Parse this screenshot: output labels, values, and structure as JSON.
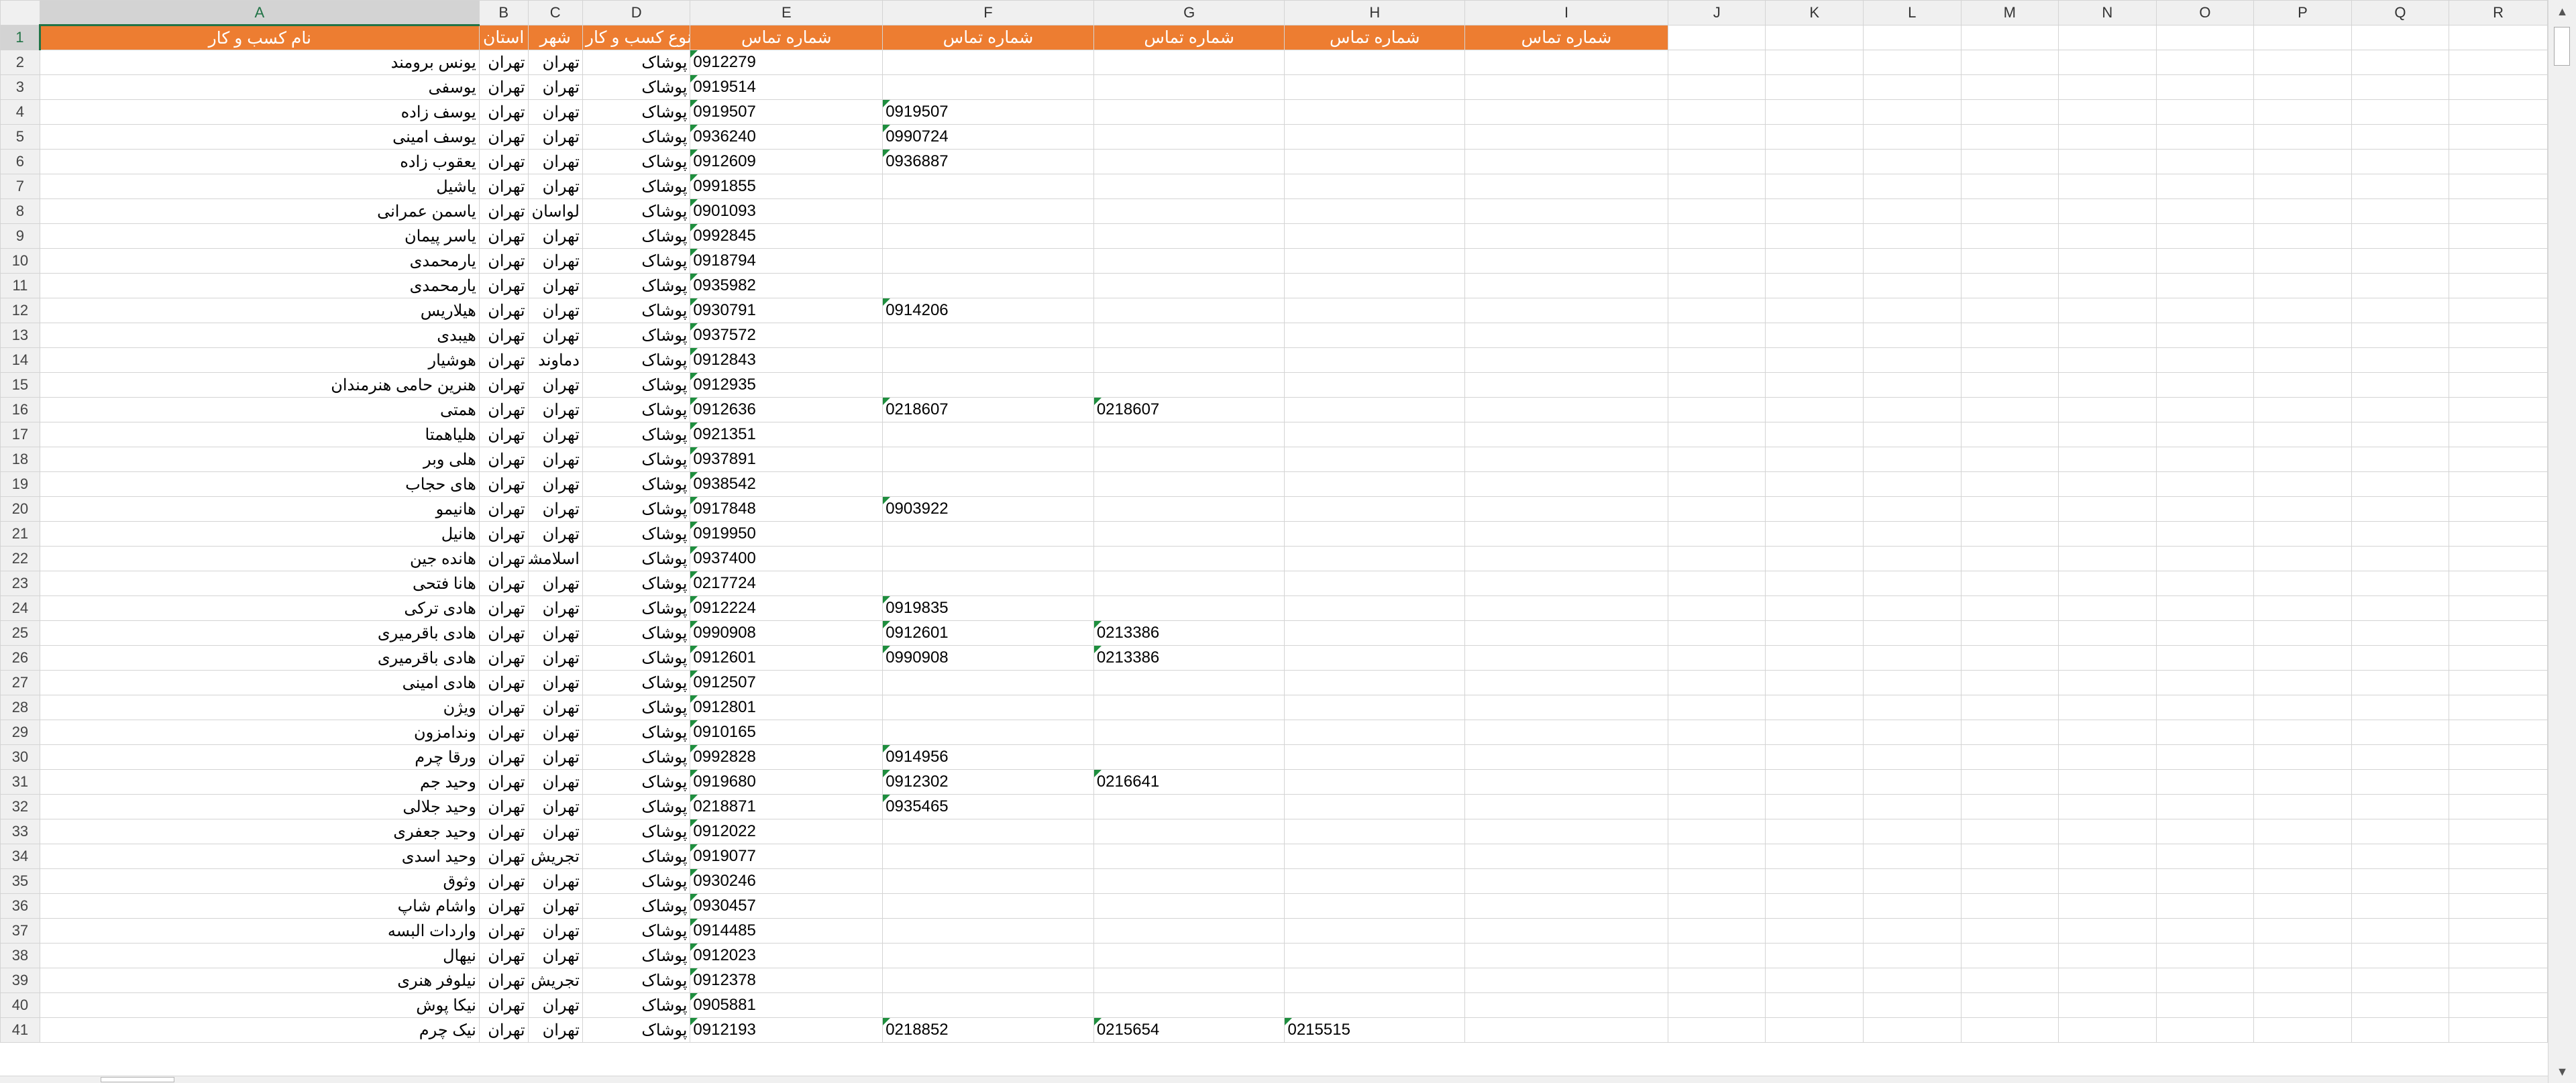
{
  "columns": [
    "A",
    "B",
    "C",
    "D",
    "E",
    "F",
    "G",
    "H",
    "I",
    "J",
    "K",
    "L",
    "M",
    "N",
    "O",
    "P",
    "Q",
    "R"
  ],
  "header_row": {
    "row_number": "1",
    "labels": [
      "نام کسب و کار",
      "استان",
      "شهر",
      "نوع کسب و کار",
      "شماره تماس",
      "شماره تماس",
      "شماره تماس",
      "شماره تماس",
      "شماره تماس"
    ]
  },
  "rows": [
    {
      "n": "2",
      "name": "یونس برومند",
      "province": "تهران",
      "city": "تهران",
      "type": "پوشاک",
      "p1": "0912279",
      "p2": "",
      "p3": "",
      "p4": ""
    },
    {
      "n": "3",
      "name": "یوسفی",
      "province": "تهران",
      "city": "تهران",
      "type": "پوشاک",
      "p1": "0919514",
      "p2": "",
      "p3": "",
      "p4": ""
    },
    {
      "n": "4",
      "name": "یوسف زاده",
      "province": "تهران",
      "city": "تهران",
      "type": "پوشاک",
      "p1": "0919507",
      "p2": "0919507",
      "p3": "",
      "p4": ""
    },
    {
      "n": "5",
      "name": "یوسف امینی",
      "province": "تهران",
      "city": "تهران",
      "type": "پوشاک",
      "p1": "0936240",
      "p2": "0990724",
      "p3": "",
      "p4": ""
    },
    {
      "n": "6",
      "name": "یعقوب زاده",
      "province": "تهران",
      "city": "تهران",
      "type": "پوشاک",
      "p1": "0912609",
      "p2": "0936887",
      "p3": "",
      "p4": ""
    },
    {
      "n": "7",
      "name": "یاشیل",
      "province": "تهران",
      "city": "تهران",
      "type": "پوشاک",
      "p1": "0991855",
      "p2": "",
      "p3": "",
      "p4": ""
    },
    {
      "n": "8",
      "name": "یاسمن عمرانی",
      "province": "تهران",
      "city": "لواسان",
      "type": "پوشاک",
      "p1": "0901093",
      "p2": "",
      "p3": "",
      "p4": ""
    },
    {
      "n": "9",
      "name": "یاسر پیمان",
      "province": "تهران",
      "city": "تهران",
      "type": "پوشاک",
      "p1": "0992845",
      "p2": "",
      "p3": "",
      "p4": ""
    },
    {
      "n": "10",
      "name": "یارمحمدی",
      "province": "تهران",
      "city": "تهران",
      "type": "پوشاک",
      "p1": "0918794",
      "p2": "",
      "p3": "",
      "p4": ""
    },
    {
      "n": "11",
      "name": "یارمحمدی",
      "province": "تهران",
      "city": "تهران",
      "type": "پوشاک",
      "p1": "0935982",
      "p2": "",
      "p3": "",
      "p4": ""
    },
    {
      "n": "12",
      "name": "هیلاریس",
      "province": "تهران",
      "city": "تهران",
      "type": "پوشاک",
      "p1": "0930791",
      "p2": "0914206",
      "p3": "",
      "p4": ""
    },
    {
      "n": "13",
      "name": "هیبدی",
      "province": "تهران",
      "city": "تهران",
      "type": "پوشاک",
      "p1": "0937572",
      "p2": "",
      "p3": "",
      "p4": ""
    },
    {
      "n": "14",
      "name": "هوشیار",
      "province": "تهران",
      "city": "دماوند",
      "type": "پوشاک",
      "p1": "0912843",
      "p2": "",
      "p3": "",
      "p4": ""
    },
    {
      "n": "15",
      "name": "هنرین حامی هنرمندان",
      "province": "تهران",
      "city": "تهران",
      "type": "پوشاک",
      "p1": "0912935",
      "p2": "",
      "p3": "",
      "p4": ""
    },
    {
      "n": "16",
      "name": "همتی",
      "province": "تهران",
      "city": "تهران",
      "type": "پوشاک",
      "p1": "0912636",
      "p2": "0218607",
      "p3": "0218607",
      "p4": ""
    },
    {
      "n": "17",
      "name": "هلیاهمتا",
      "province": "تهران",
      "city": "تهران",
      "type": "پوشاک",
      "p1": "0921351",
      "p2": "",
      "p3": "",
      "p4": ""
    },
    {
      "n": "18",
      "name": "هلی وبر",
      "province": "تهران",
      "city": "تهران",
      "type": "پوشاک",
      "p1": "0937891",
      "p2": "",
      "p3": "",
      "p4": ""
    },
    {
      "n": "19",
      "name": "های حجاب",
      "province": "تهران",
      "city": "تهران",
      "type": "پوشاک",
      "p1": "0938542",
      "p2": "",
      "p3": "",
      "p4": ""
    },
    {
      "n": "20",
      "name": "هانیمو",
      "province": "تهران",
      "city": "تهران",
      "type": "پوشاک",
      "p1": "0917848",
      "p2": "0903922",
      "p3": "",
      "p4": ""
    },
    {
      "n": "21",
      "name": "هانیل",
      "province": "تهران",
      "city": "تهران",
      "type": "پوشاک",
      "p1": "0919950",
      "p2": "",
      "p3": "",
      "p4": ""
    },
    {
      "n": "22",
      "name": "هانده جین",
      "province": "تهران",
      "city": "اسلامشهر",
      "type": "پوشاک",
      "p1": "0937400",
      "p2": "",
      "p3": "",
      "p4": ""
    },
    {
      "n": "23",
      "name": "هانا فتحی",
      "province": "تهران",
      "city": "تهران",
      "type": "پوشاک",
      "p1": "0217724",
      "p2": "",
      "p3": "",
      "p4": ""
    },
    {
      "n": "24",
      "name": "هادی ترکی",
      "province": "تهران",
      "city": "تهران",
      "type": "پوشاک",
      "p1": "0912224",
      "p2": "0919835",
      "p3": "",
      "p4": ""
    },
    {
      "n": "25",
      "name": "هادی باقرمیری",
      "province": "تهران",
      "city": "تهران",
      "type": "پوشاک",
      "p1": "0990908",
      "p2": "0912601",
      "p3": "0213386",
      "p4": ""
    },
    {
      "n": "26",
      "name": "هادی باقرمیری",
      "province": "تهران",
      "city": "تهران",
      "type": "پوشاک",
      "p1": "0912601",
      "p2": "0990908",
      "p3": "0213386",
      "p4": ""
    },
    {
      "n": "27",
      "name": "هادی امینی",
      "province": "تهران",
      "city": "تهران",
      "type": "پوشاک",
      "p1": "0912507",
      "p2": "",
      "p3": "",
      "p4": ""
    },
    {
      "n": "28",
      "name": "ویژن",
      "province": "تهران",
      "city": "تهران",
      "type": "پوشاک",
      "p1": "0912801",
      "p2": "",
      "p3": "",
      "p4": ""
    },
    {
      "n": "29",
      "name": "وندامزون",
      "province": "تهران",
      "city": "تهران",
      "type": "پوشاک",
      "p1": "0910165",
      "p2": "",
      "p3": "",
      "p4": ""
    },
    {
      "n": "30",
      "name": "ورقا چرم",
      "province": "تهران",
      "city": "تهران",
      "type": "پوشاک",
      "p1": "0992828",
      "p2": "0914956",
      "p3": "",
      "p4": ""
    },
    {
      "n": "31",
      "name": "وحید جم",
      "province": "تهران",
      "city": "تهران",
      "type": "پوشاک",
      "p1": "0919680",
      "p2": "0912302",
      "p3": "0216641",
      "p4": ""
    },
    {
      "n": "32",
      "name": "وحید جلالی",
      "province": "تهران",
      "city": "تهران",
      "type": "پوشاک",
      "p1": "0218871",
      "p2": "0935465",
      "p3": "",
      "p4": ""
    },
    {
      "n": "33",
      "name": "وحید جعفری",
      "province": "تهران",
      "city": "تهران",
      "type": "پوشاک",
      "p1": "0912022",
      "p2": "",
      "p3": "",
      "p4": ""
    },
    {
      "n": "34",
      "name": "وحید اسدی",
      "province": "تهران",
      "city": "تجریش",
      "type": "پوشاک",
      "p1": "0919077",
      "p2": "",
      "p3": "",
      "p4": ""
    },
    {
      "n": "35",
      "name": "وثوق",
      "province": "تهران",
      "city": "تهران",
      "type": "پوشاک",
      "p1": "0930246",
      "p2": "",
      "p3": "",
      "p4": ""
    },
    {
      "n": "36",
      "name": "واشام شاپ",
      "province": "تهران",
      "city": "تهران",
      "type": "پوشاک",
      "p1": "0930457",
      "p2": "",
      "p3": "",
      "p4": ""
    },
    {
      "n": "37",
      "name": "واردات البسه",
      "province": "تهران",
      "city": "تهران",
      "type": "پوشاک",
      "p1": "0914485",
      "p2": "",
      "p3": "",
      "p4": ""
    },
    {
      "n": "38",
      "name": "نیهال",
      "province": "تهران",
      "city": "تهران",
      "type": "پوشاک",
      "p1": "0912023",
      "p2": "",
      "p3": "",
      "p4": ""
    },
    {
      "n": "39",
      "name": "نیلوفر هنری",
      "province": "تهران",
      "city": "تجریش",
      "type": "پوشاک",
      "p1": "0912378",
      "p2": "",
      "p3": "",
      "p4": ""
    },
    {
      "n": "40",
      "name": "نیکا پوش",
      "province": "تهران",
      "city": "تهران",
      "type": "پوشاک",
      "p1": "0905881",
      "p2": "",
      "p3": "",
      "p4": ""
    },
    {
      "n": "41",
      "name": "نیک چرم",
      "province": "تهران",
      "city": "تهران",
      "type": "پوشاک",
      "p1": "0912193",
      "p2": "0218852",
      "p3": "0215654",
      "p4": "0215515"
    }
  ],
  "colors": {
    "header_fill": "#ed7d31",
    "header_text": "#ffffff",
    "gridline": "#d4d4d4",
    "selected_header_text": "#217346",
    "comment_triangle": "#1e8e3e"
  },
  "icons": {
    "scroll_up": "▲",
    "scroll_down": "▼"
  }
}
